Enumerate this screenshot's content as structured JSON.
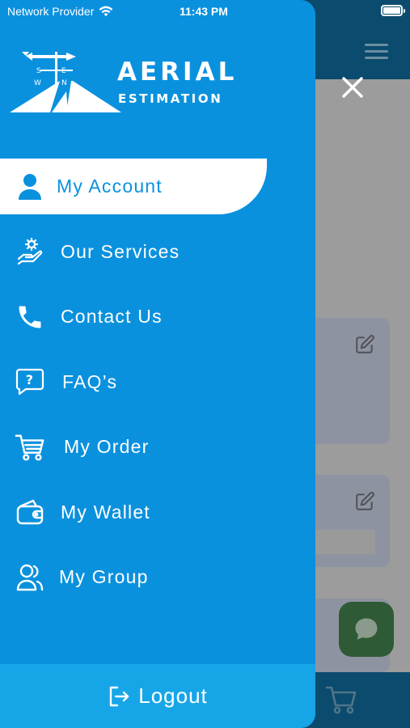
{
  "status_bar": {
    "carrier": "Network Provider",
    "time": "11:43 PM",
    "wifi_icon": "wifi-icon",
    "battery_icon": "battery-full-icon"
  },
  "logo": {
    "title": "AERIAL",
    "subtitle": "ESTIMATION",
    "compass": [
      "N",
      "S",
      "E",
      "W"
    ],
    "icon": "weathervane-house-logo"
  },
  "menu": {
    "items": [
      {
        "label": "My Account",
        "icon": "user-icon",
        "active": true
      },
      {
        "label": "Our Services",
        "icon": "hand-services-icon",
        "active": false
      },
      {
        "label": "Contact Us",
        "icon": "phone-icon",
        "active": false
      },
      {
        "label": "FAQ’s",
        "icon": "question-bubble-icon",
        "active": false
      },
      {
        "label": "My Order",
        "icon": "cart-icon",
        "active": false
      },
      {
        "label": "My Wallet",
        "icon": "wallet-icon",
        "active": false
      },
      {
        "label": "My Group",
        "icon": "group-icon",
        "active": false
      }
    ]
  },
  "logout": {
    "label": "Logout",
    "icon": "logout-icon"
  },
  "background_app": {
    "close_icon": "close-icon",
    "hamburger_icon": "hamburger-icon",
    "edit_icon": "edit-icon",
    "chat_icon": "chat-bubble-icon",
    "cart_icon": "cart-icon"
  },
  "colors": {
    "drawer_blue": "#0a91de",
    "logout_blue": "#16a6e8",
    "active_item_bg": "#ffffff",
    "app_header_dark": "#0b4b6d",
    "overlay_grey": "#9c9c9c",
    "chat_green": "#2e5a35"
  }
}
